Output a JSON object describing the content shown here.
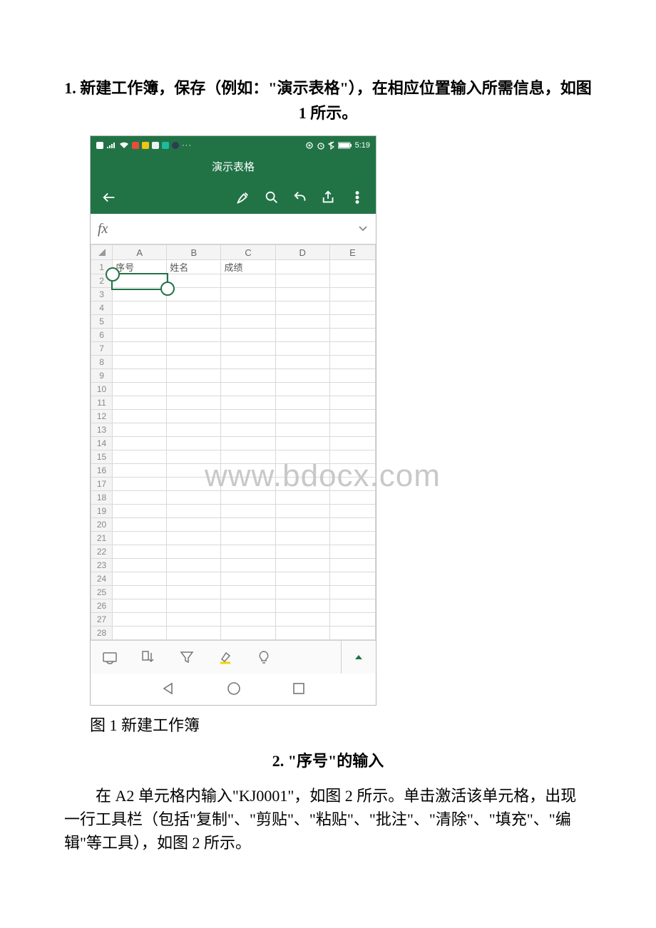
{
  "doc": {
    "heading1": "1. 新建工作簿，保存（例如：\"演示表格\"），在相应位置输入所需信息，如图 1 所示。",
    "caption1": "图 1 新建工作簿",
    "heading2": "2. \"序号\"的输入",
    "body2": "在 A2 单元格内输入\"KJ0001\"，如图 2 所示。单击激活该单元格，出现一行工具栏（包括\"复制\"、\"剪贴\"、\"粘贴\"、\"批注\"、\"清除\"、\"填充\"、\"编辑\"等工具），如图 2 所示。"
  },
  "watermark": "www.bdocx.com",
  "excel": {
    "statusbar": {
      "time": "5:19"
    },
    "title": "演示表格",
    "fx_symbol": "fx",
    "columns": [
      "A",
      "B",
      "C",
      "D",
      "E"
    ],
    "row_count": 28,
    "headers": {
      "A1": "序号",
      "B1": "姓名",
      "C1": "成绩"
    },
    "selected_cell": "A2"
  }
}
